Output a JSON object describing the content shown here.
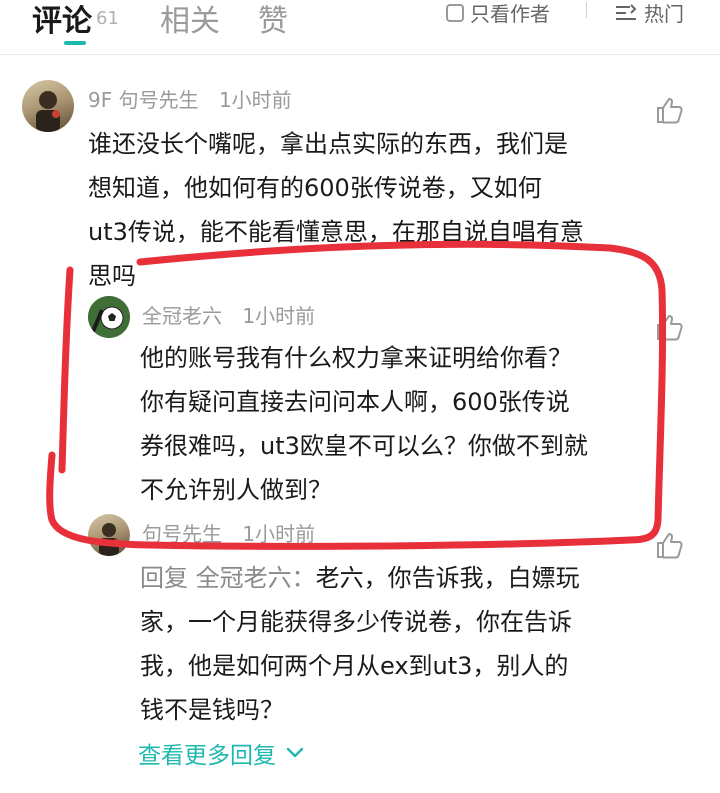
{
  "tabs": {
    "comments_label": "评论",
    "comments_count": "61",
    "related_label": "相关",
    "likes_label": "赞"
  },
  "filters": {
    "author_only_label": "只看作者",
    "sort_label": "热门"
  },
  "comment": {
    "floor": "9F",
    "author": "句号先生",
    "time": "1小时前",
    "lines": [
      "谁还没长个嘴呢，拿出点实际的东西，我们是",
      "想知道，他如何有的600张传说卷，又如何",
      "ut3传说，能不能看懂意思，在那自说自唱有意",
      "思吗"
    ]
  },
  "replies": [
    {
      "author": "全冠老六",
      "time": "1小时前",
      "lines": [
        "他的账号我有什么权力拿来证明给你看？",
        "你有疑问直接去问问本人啊，600张传说",
        "券很难吗，ut3欧皇不可以么？你做不到就",
        "不允许别人做到？"
      ]
    },
    {
      "author": "句号先生",
      "time": "1小时前",
      "reply_to_prefix": "回复 全冠老六：",
      "lines": [
        "老六，你告诉我，白嫖玩",
        "家，一个月能获得多少传说卷，你在告诉",
        "我，他是如何两个月从ex到ut3，别人的",
        "钱不是钱吗？"
      ]
    }
  ],
  "more_replies_label": "查看更多回复",
  "colors": {
    "accent": "#1fb8b0",
    "annotation": "#e8303a",
    "meta": "#9a9a9a"
  }
}
